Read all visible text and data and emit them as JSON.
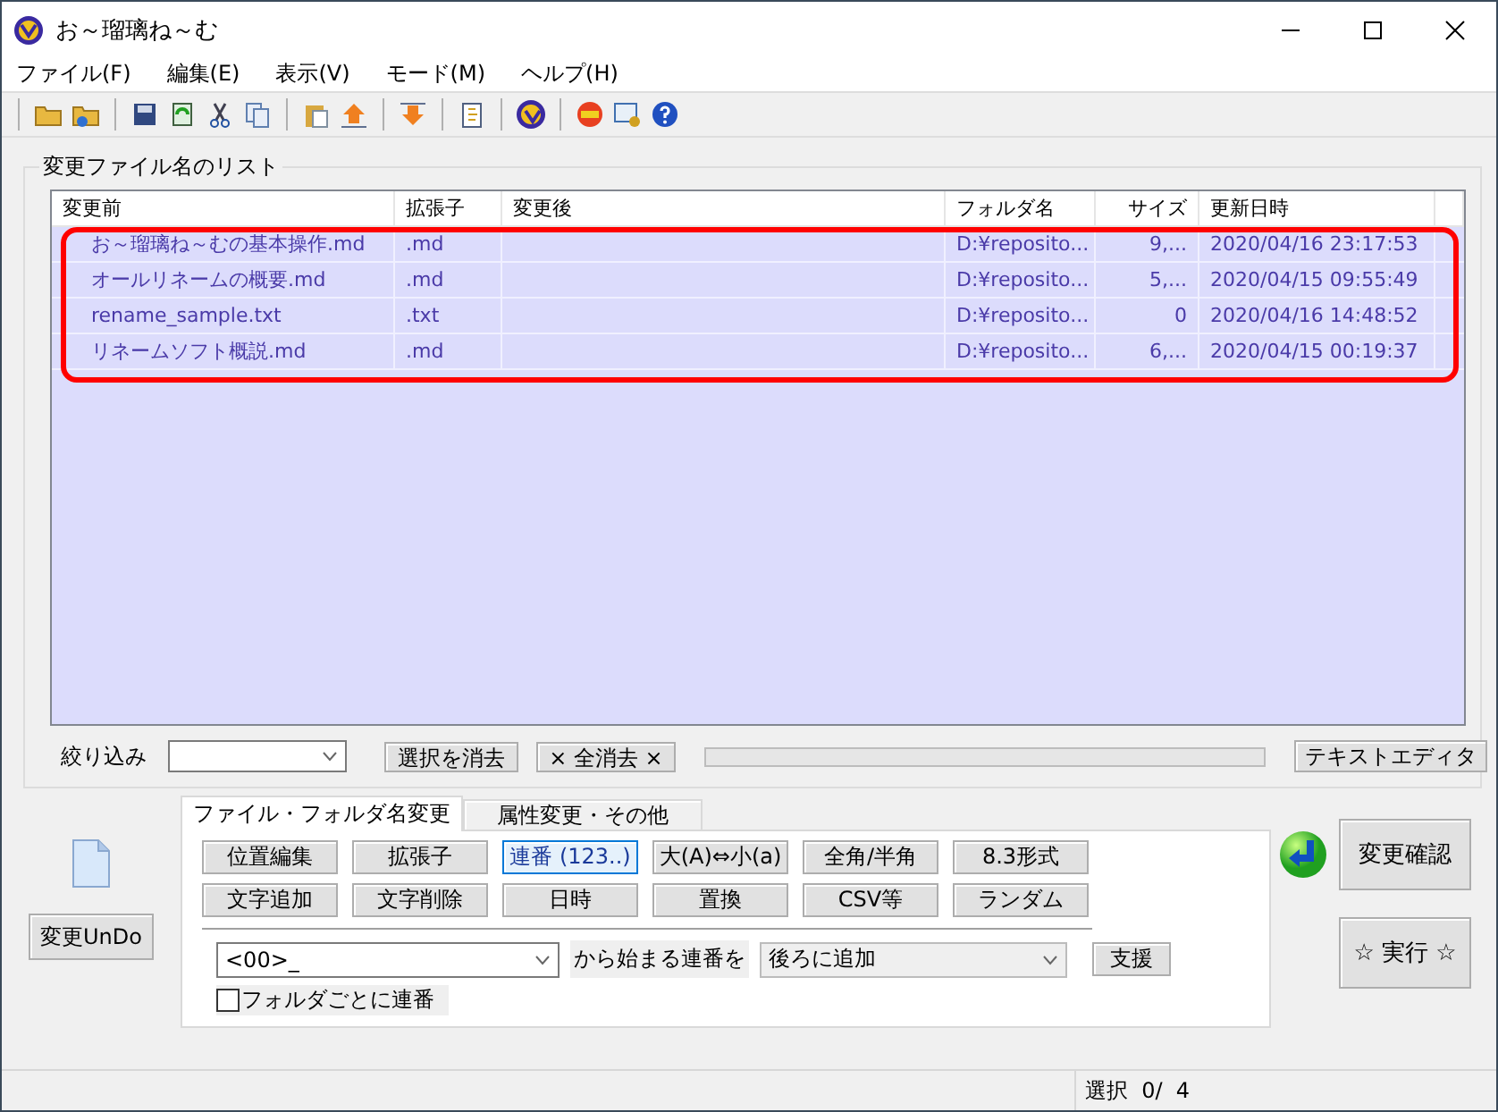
{
  "window": {
    "title": "お～瑠璃ね～む"
  },
  "menu": [
    "ファイル(F)",
    "編集(E)",
    "表示(V)",
    "モード(M)",
    "ヘルプ(H)"
  ],
  "list_group": {
    "title": "変更ファイル名のリスト"
  },
  "table": {
    "columns": [
      "変更前",
      "拡張子",
      "変更後",
      "フォルダ名",
      "サイズ",
      "更新日時"
    ],
    "rows": [
      {
        "cells": [
          "お～瑠璃ね～むの基本操作.md",
          ".md",
          "",
          "D:¥reposito...",
          "9,...",
          "2020/04/16 23:17:53"
        ]
      },
      {
        "cells": [
          "オールリネームの概要.md",
          ".md",
          "",
          "D:¥reposito...",
          "5,...",
          "2020/04/15 09:55:49"
        ]
      },
      {
        "cells": [
          "rename_sample.txt",
          ".txt",
          "",
          "D:¥reposito...",
          "0",
          "2020/04/16 14:48:52"
        ]
      },
      {
        "cells": [
          "リネームソフト概説.md",
          ".md",
          "",
          "D:¥reposito...",
          "6,...",
          "2020/04/15 00:19:37"
        ]
      }
    ]
  },
  "filter": {
    "progress": {
      "level": 0
    },
    "label": "絞り込み",
    "clear_selection": "選択を消去",
    "clear_all": "× 全消去 ×",
    "text_editor": "テキストエディタ"
  },
  "tabs": [
    {
      "label": "ファイル・フォルダ名変更",
      "selected": true
    },
    {
      "label": "属性変更・その他",
      "selected": false
    }
  ],
  "modes": [
    {
      "label": "位置編集",
      "selected": false
    },
    {
      "label": "拡張子",
      "selected": false
    },
    {
      "label": "連番 (123..)",
      "selected": true
    },
    {
      "label": "大(A)⇔小(a)",
      "selected": false
    },
    {
      "label": "全角/半角",
      "selected": false
    },
    {
      "label": "8.3形式",
      "selected": false
    },
    {
      "label": "文字追加",
      "selected": false
    },
    {
      "label": "文字削除",
      "selected": false
    },
    {
      "label": "日時",
      "selected": false
    },
    {
      "label": "置換",
      "selected": false
    },
    {
      "label": "CSV等",
      "selected": false
    },
    {
      "label": "ランダム",
      "selected": false
    }
  ],
  "numbering": {
    "format": "<00>_",
    "label": "から始まる連番を",
    "position": "後ろに追加",
    "help_button": "支援",
    "per_folder": {
      "label": "フォルダごとに連番",
      "checked": false
    }
  },
  "undo_button": "変更UnDo",
  "confirm_button": "変更確認",
  "run_button": "☆ 実行 ☆",
  "status_bar": {
    "selection": "選択  0/  4"
  }
}
